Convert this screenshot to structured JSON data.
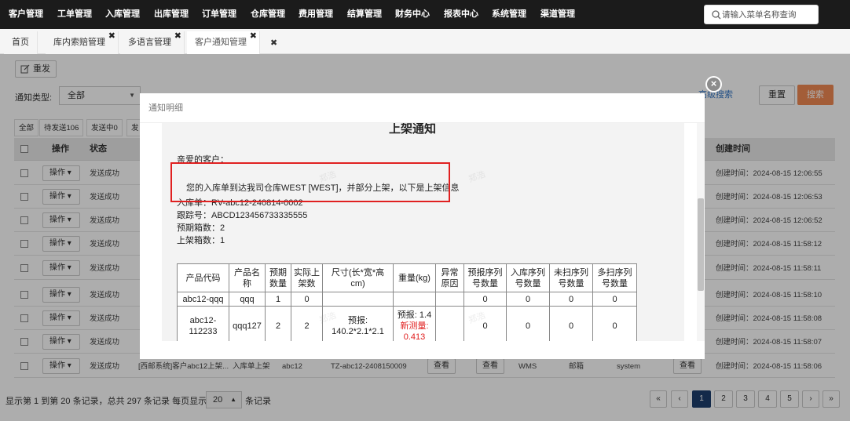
{
  "nav": {
    "items": [
      "客户管理",
      "工单管理",
      "入库管理",
      "出库管理",
      "订单管理",
      "仓库管理",
      "费用管理",
      "结算管理",
      "财务中心",
      "报表中心",
      "系统管理",
      "渠道管理"
    ],
    "search_placeholder": "请输入菜单名称查询"
  },
  "tabs": [
    "首页",
    "库内索赔管理",
    "多语言管理",
    "客户通知管理"
  ],
  "toolbar": {
    "resend": "重发"
  },
  "filters": {
    "notice_type_label": "通知类型:",
    "notice_type_value": "全部",
    "advanced": "高级搜索",
    "reset": "重置",
    "search": "搜索"
  },
  "subtabs": [
    "全部",
    "待发送106",
    "发送中0",
    "发"
  ],
  "table": {
    "headers": {
      "op": "操作",
      "status": "状态",
      "created": "创建时间"
    },
    "rows": [
      {
        "op": "操作",
        "status": "发送成功",
        "created": "创建时间：2024-08-15 12:06:55"
      },
      {
        "op": "操作",
        "status": "发送成功",
        "created": "创建时间：2024-08-15 12:06:53"
      },
      {
        "op": "操作",
        "status": "发送成功",
        "created": "创建时间：2024-08-15 12:06:52"
      },
      {
        "op": "操作",
        "status": "发送成功",
        "created": "创建时间：2024-08-15 11:58:12"
      },
      {
        "op": "操作",
        "status": "发送成功",
        "created": "创建时间：2024-08-15 11:58:11"
      },
      {
        "op": "操作",
        "status": "发送成功",
        "created": "创建时间：2024-08-15 11:58:10"
      },
      {
        "op": "操作",
        "status": "发送成功",
        "created": "创建时间：2024-08-15 11:58:08"
      },
      {
        "op": "操作",
        "status": "发送成功",
        "created": "创建时间：2024-08-15 11:58:07"
      },
      {
        "op": "操作",
        "status": "发送成功",
        "created": "创建时间：2024-08-15 11:58:06",
        "subject": "[西邮系统]客户abc12上架...",
        "kind": "入库单上架",
        "customer": "abc12",
        "order": "TZ-abc12-2408150009",
        "view1": "查看",
        "view2": "查看",
        "channel": "WMS",
        "method": "邮箱",
        "sender": "system",
        "view3": "查看"
      }
    ]
  },
  "pagination": {
    "info": "显示第 1 到第 20 条记录，总共 297 条记录 每页显示",
    "page_size": "20",
    "tail": "条记录",
    "pages": [
      "«",
      "‹",
      "1",
      "2",
      "3",
      "4",
      "5",
      "›",
      "»"
    ]
  },
  "modal": {
    "title": "通知明细",
    "doc_title": "上架通知",
    "greeting": "亲爱的客户：",
    "message": "您的入库单到达我司仓库WEST [WEST]，并部分上架，以下是上架信息",
    "receipt": "入库单：RV-abc12-240814-0002",
    "tracking": "跟踪号：ABCD123456733335555",
    "expected_boxes": "预期箱数：2",
    "shelved_boxes": "上架箱数：1",
    "columns": [
      "产品代码",
      "产品名称",
      "预期数量",
      "实际上架数",
      "尺寸(长*宽*高cm)",
      "重量(kg)",
      "异常原因",
      "预报序列号数量",
      "入库序列号数量",
      "未扫序列号数量",
      "多扫序列号数量"
    ],
    "rows": [
      {
        "code": "abc12-qqq",
        "name": "qqq",
        "expected": "1",
        "actual": "0",
        "size": "",
        "weight": "",
        "reason": "",
        "s1": "0",
        "s2": "0",
        "s3": "0",
        "s4": "0"
      },
      {
        "code": "abc12-112233",
        "name": "qqq127",
        "expected": "2",
        "actual": "2",
        "size": "预报: 140.2*2.1*2.1",
        "weight_forecast": "预报: 1.4",
        "weight_measured": "新测量: 0.413",
        "reason": "",
        "s1": "0",
        "s2": "0",
        "s3": "0",
        "s4": "0"
      }
    ],
    "watermark": "郑浩"
  }
}
